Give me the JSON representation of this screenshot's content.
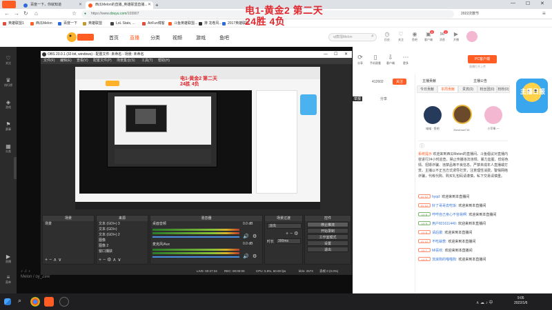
{
  "browser": {
    "tabs": [
      {
        "label": "百度一下，你就知道"
      },
      {
        "label": "西瓜Melon的直播_英雄联盟直播..."
      },
      {
        "label": "+"
      }
    ],
    "url_prefix": "https://www.",
    "url_host": "douyu.com",
    "url_path": "/103907",
    "addr_right": "2022次数节"
  },
  "bookmarks": [
    "英雄联盟1",
    "西瓜Melon",
    "百度一下",
    "英雄联盟",
    "LoL Stats, ...",
    "AirFun博客",
    "斗鱼英雄联盟...",
    "排 龙卷风...",
    "2017英雄联盟..."
  ],
  "overlay": {
    "line1": "电1-黄金2   第二天",
    "line2": "24胜  4负"
  },
  "douyu_nav": {
    "items": [
      "首页",
      "直播",
      "分类",
      "视频",
      "游戏",
      "鱼吧"
    ],
    "active": "直播",
    "search_placeholder": "ql蒸馏Melon",
    "icons": [
      {
        "label": "历史",
        "icon": "clock-icon"
      },
      {
        "label": "关注",
        "icon": "heart-icon"
      },
      {
        "label": "鱼吧",
        "icon": "fish-icon"
      },
      {
        "label": "客户端",
        "icon": "gift-icon",
        "badge": "6"
      },
      {
        "label": "消息",
        "icon": "message-icon",
        "badge": "4"
      },
      {
        "label": "开播",
        "icon": "live-icon"
      }
    ]
  },
  "left_rail": [
    "关注",
    "排行榜",
    "游戏",
    "赛事",
    "分类",
    "直播",
    "菜单"
  ],
  "obs": {
    "title": "OBS 23.0.1 (32-bit, windows) - 配置文件: 未命名 - 场景: 未命名",
    "menu": [
      "文件(F)",
      "编辑(E)",
      "查看(V)",
      "配置文件(P)",
      "场景集合(S)",
      "工具(T)",
      "帮助(H)"
    ],
    "preview_title_line1": "电1-黄金2  第二天",
    "preview_title_line2": "24胜  4负",
    "docks": {
      "scenes": {
        "title": "场景",
        "items": [
          "场景"
        ]
      },
      "sources": {
        "title": "来源",
        "items": [
          "文本 (GDI+) 3",
          "文本 (GDI+)",
          "文本 (GDI+) 2",
          "图像",
          "图像 2",
          "窗口捕获"
        ]
      },
      "mixer": {
        "title": "混音器",
        "tracks": [
          {
            "name": "桌面音频",
            "db": "0.0 dB"
          },
          {
            "name": "麦克风/Aux",
            "db": "0.0 dB"
          }
        ]
      },
      "transitions": {
        "title": "场景过渡",
        "mode": "淡出",
        "duration_label": "时长",
        "duration": "300ms"
      },
      "controls": {
        "title": "控件",
        "buttons": [
          "停止推流",
          "开始录制",
          "工作室模式",
          "设置",
          "退出"
        ]
      }
    },
    "status": [
      "LIVE: 00:27:34",
      "REC: 00:00:00",
      "CPU: 5.8%, 60.00 fps",
      "kb/s: 2573",
      "丢帧 0 (0.0%)"
    ]
  },
  "stream_info": {
    "icons": [
      {
        "label": "分享",
        "icon": "share-icon"
      },
      {
        "label": "手机观看",
        "icon": "phone-icon"
      },
      {
        "label": "客户端",
        "icon": "download-icon"
      },
      {
        "label": "更多",
        "icon": "more-icon"
      }
    ],
    "pc_button": "PC客户端",
    "pc_sub": "直播打开上传"
  },
  "mini_toolbar": {
    "count": "412602",
    "follow": "关注",
    "share": "分享",
    "report": "举报"
  },
  "chat": {
    "header_left": "主播贡献",
    "header_right": "主播公告",
    "tabs": [
      "今日贡献",
      "本周贡献",
      "贵宾(0)",
      "粉丝团(0)",
      "粉粉(0)"
    ],
    "top_users": [
      {
        "name": "喵喵 · 鱼吧"
      },
      {
        "name": "Kimchow715"
      },
      {
        "name": "小苹果-一"
      }
    ],
    "system_label": "系统提示",
    "system_text": "欢迎来到西瓜Melon的直播间。斗鱼倡议对直播内容进行24小时巡查，禁止传播违法违规、暴力血腥、低俗色情、招嫖诈骗、违禁品等不良信息。严禁未成年人直播或打赏。主播以不正当方式诱导打赏，注意理性消费。警惕网络诈骗，代练代购、购买礼包码请谨慎，私下交易请慎重。",
    "messages": [
      {
        "level": "LV 12",
        "name": "hyqd:",
        "text": "欢迎来到本直播间"
      },
      {
        "level": "LV 12",
        "name": "好了哥哥去吃饭:",
        "text": "欢迎来到本直播间"
      },
      {
        "level": "LV 8",
        "name": "哼哼自己身心不容易啊:",
        "text": "欢迎来到本直播间"
      },
      {
        "level": "LV 9",
        "name": "用户821611440:",
        "text": "欢迎来到本直播间"
      },
      {
        "level": "LV 8",
        "name": "请后援:",
        "text": "欢迎来到本直播间"
      },
      {
        "level": "LV 12",
        "name": "不吃蒜葱:",
        "text": "欢迎来到本直播间"
      },
      {
        "level": "LV 7",
        "name": "Ml喜欢:",
        "text": "欢迎来到本直播间"
      },
      {
        "level": "LV 9",
        "name": "流浪狗的喵喵狗:",
        "text": "欢迎来到本直播间"
      }
    ]
  },
  "banner_text": "主播日报",
  "taskbar": {
    "time": "9:05",
    "date": "2022/1/6"
  },
  "watermark_name": "Melon"
}
